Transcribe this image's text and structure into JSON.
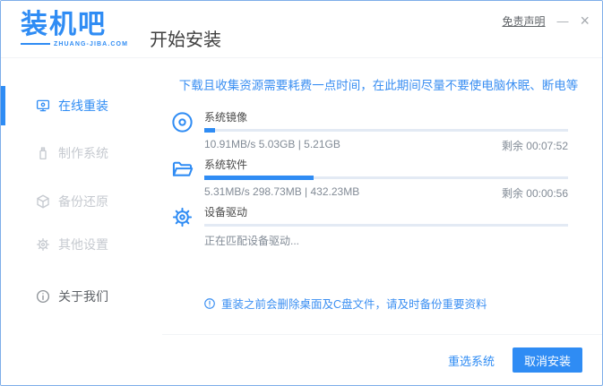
{
  "brand": {
    "logo_text": "装机吧",
    "logo_subtext": "ZHUANG-JIBA.COM"
  },
  "titlebar": {
    "disclaimer_label": "免责声明",
    "minimize_glyph": "—",
    "close_glyph": "×"
  },
  "header": {
    "title": "开始安装"
  },
  "sidebar": {
    "items": [
      {
        "label": "在线重装",
        "icon": "monitor-icon",
        "active": true
      },
      {
        "label": "制作系统",
        "icon": "usb-drive-icon",
        "active": false
      },
      {
        "label": "备份还原",
        "icon": "package-icon",
        "active": false
      },
      {
        "label": "其他设置",
        "icon": "gear-icon",
        "active": false
      },
      {
        "label": "关于我们",
        "icon": "info-icon",
        "active": false
      }
    ]
  },
  "main": {
    "notice": "下载且收集资源需要耗费一点时间，在此期间尽量不要使电脑休眠、断电等",
    "tasks": [
      {
        "name": "系统镜像",
        "icon": "disc-icon",
        "progress_percent": 3,
        "detail": "10.91MB/s 5.03GB | 5.21GB",
        "remaining": "剩余 00:07:52"
      },
      {
        "name": "系统软件",
        "icon": "folder-icon",
        "progress_percent": 30,
        "detail": "5.31MB/s 298.73MB | 432.23MB",
        "remaining": "剩余 00:00:56"
      },
      {
        "name": "设备驱动",
        "icon": "gear-icon",
        "progress_percent": 0,
        "detail": "正在匹配设备驱动...",
        "remaining": ""
      }
    ],
    "warning": "重装之前会删除桌面及C盘文件，请及时备份重要资料"
  },
  "footer": {
    "reselect_label": "重选系统",
    "cancel_label": "取消安装"
  },
  "colors": {
    "accent": "#2f8cf4",
    "notice_blue": "#3b8ff2",
    "progress_track": "#e3eaf4",
    "text_dark": "#4a4a4a",
    "text_gray": "#828b96",
    "sidebar_inactive": "#c6cad0",
    "window_border": "#7eaee9",
    "button_text": "#ffffff"
  }
}
